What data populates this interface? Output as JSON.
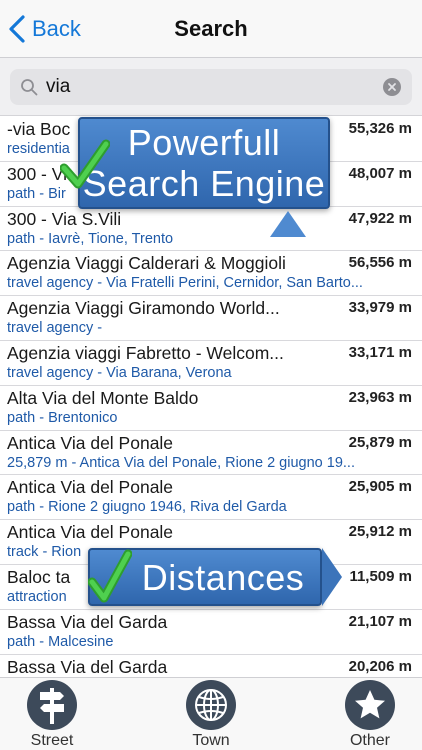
{
  "nav": {
    "back_label": "Back",
    "title": "Search"
  },
  "search": {
    "value": "via"
  },
  "results": [
    {
      "name": "-via Boc",
      "sub": "residentia",
      "dist": "55,326 m"
    },
    {
      "name": "300 - Vi",
      "sub": "path - Bir",
      "dist": "48,007 m"
    },
    {
      "name": "300 - Via S.Vili",
      "sub": "path - Iavrè, Tione, Trento",
      "dist": "47,922 m"
    },
    {
      "name": "Agenzia Viaggi Calderari & Moggioli",
      "sub": "travel agency - Via Fratelli Perini, Cernidor, San Barto...",
      "dist": "56,556 m"
    },
    {
      "name": "Agenzia Viaggi Giramondo World...",
      "sub": "travel agency -",
      "dist": "33,979 m"
    },
    {
      "name": "Agenzia viaggi Fabretto - Welcom...",
      "sub": "travel agency - Via Barana, Verona",
      "dist": "33,171 m"
    },
    {
      "name": "Alta Via del Monte Baldo",
      "sub": "path - Brentonico",
      "dist": "23,963 m"
    },
    {
      "name": "Antica Via del Ponale",
      "sub": "25,879 m - Antica Via del Ponale, Rione 2 giugno 19...",
      "dist": "25,879 m"
    },
    {
      "name": "Antica Via del Ponale",
      "sub": "path - Rione 2 giugno 1946, Riva del Garda",
      "dist": "25,905 m"
    },
    {
      "name": "Antica Via del Ponale",
      "sub": "track - Rion",
      "dist": "25,912 m"
    },
    {
      "name": "Baloc ta",
      "sub": "attraction",
      "dist": "11,509 m"
    },
    {
      "name": "Bassa Via del Garda",
      "sub": "path - Malcesine",
      "dist": "21,107 m"
    },
    {
      "name": "Bassa Via del Garda",
      "sub": "",
      "dist": "20,206 m"
    }
  ],
  "tabs": [
    {
      "label": "Street",
      "icon": "signpost-icon"
    },
    {
      "label": "Town",
      "icon": "globe-icon"
    },
    {
      "label": "Other",
      "icon": "star-icon"
    }
  ],
  "promo": {
    "search_line1": "Powerfull",
    "search_line2": "Search Engine",
    "distances": "Distances"
  },
  "colors": {
    "accent": "#1478d8",
    "subtitle": "#1f5aa8",
    "promo_blue": "#3c74ba",
    "check_green": "#3fbf3f",
    "tab_icon": "#3d4a5a"
  }
}
